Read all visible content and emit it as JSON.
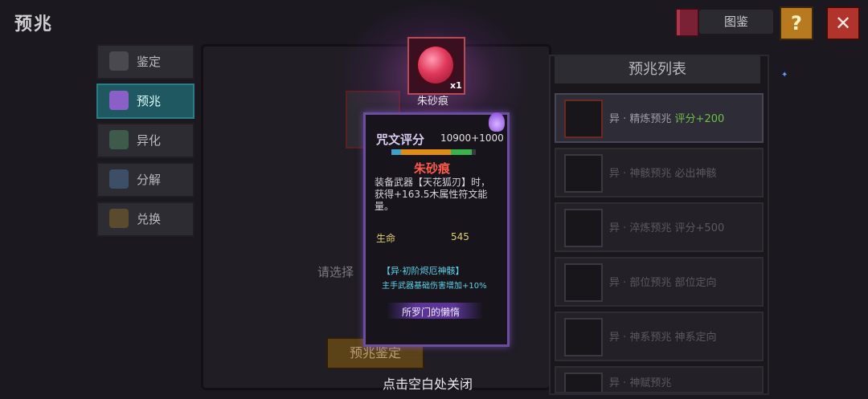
{
  "header": {
    "title": "预兆",
    "codex_label": "图鉴",
    "help_symbol": "?",
    "close_symbol": "✕"
  },
  "sidebar": {
    "items": [
      {
        "label": "鉴定",
        "icon": "identify-icon",
        "active": false
      },
      {
        "label": "预兆",
        "icon": "omen-icon",
        "active": true
      },
      {
        "label": "异化",
        "icon": "mutation-icon",
        "active": false
      },
      {
        "label": "分解",
        "icon": "decompose-icon",
        "active": false
      },
      {
        "label": "兑换",
        "icon": "exchange-icon",
        "active": false
      }
    ]
  },
  "center": {
    "prompt": "请选择",
    "identify_button": "预兆鉴定"
  },
  "item": {
    "name": "朱砂痕",
    "count": "x1"
  },
  "tooltip": {
    "rune_label": "咒文评分",
    "rune_value": "10900+1000",
    "name": "朱砂痕",
    "description": "装备武器【天花狐刃】时，获得+163.5木属性符文能量。",
    "stat_label": "生命",
    "stat_value": "545",
    "set_name": "【异·初阶烬厄神骸】",
    "set_effect": "主手武器基础伤害增加+10%",
    "source": "所罗门的懒惰"
  },
  "omen_list": {
    "title": "预兆列表",
    "items": [
      {
        "text": "异 · 精炼预兆",
        "bonus": "评分+200",
        "active": true
      },
      {
        "text": "异 · 神骸预兆 必出神骸",
        "bonus": "",
        "active": false
      },
      {
        "text": "异 · 淬炼预兆 评分+500",
        "bonus": "",
        "active": false
      },
      {
        "text": "异 · 部位预兆 部位定向",
        "bonus": "",
        "active": false
      },
      {
        "text": "异 · 神系预兆 神系定向",
        "bonus": "",
        "active": false
      },
      {
        "text": "异 · 神赋预兆",
        "bonus": "",
        "active": false
      }
    ]
  },
  "footer": {
    "dismiss_hint": "点击空白处关闭"
  },
  "colors": {
    "accent_teal": "#1f5860",
    "rarity_red": "#ff5a4a",
    "bonus_green": "#6ec04a",
    "tooltip_border": "#6b4f9e"
  }
}
